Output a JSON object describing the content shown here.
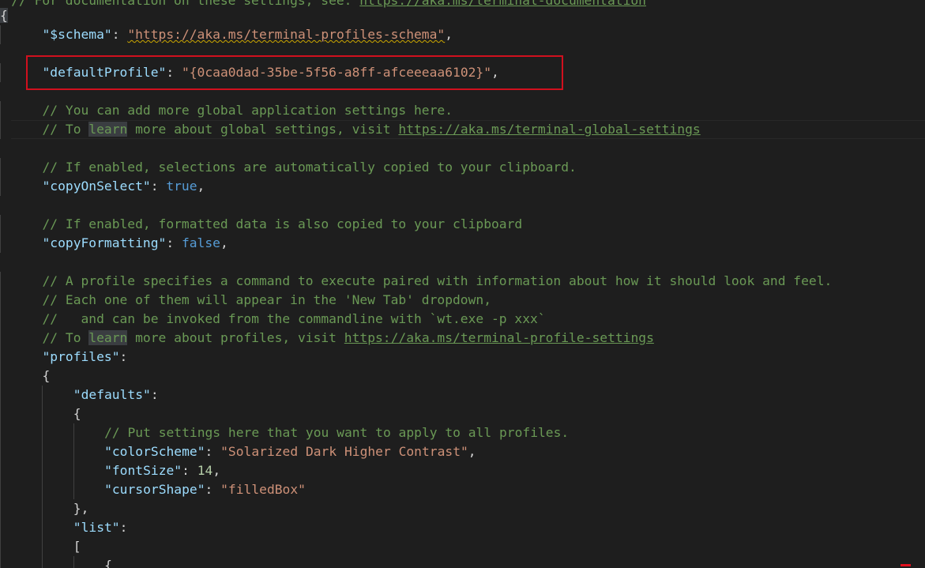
{
  "editor": {
    "lines": {
      "top_comment": {
        "text": "// For documentation on these settings, see: ",
        "url": "https://aka.ms/terminal-documentation"
      },
      "open_brace": "{",
      "schema": {
        "key": "\"$schema\"",
        "colon": ": ",
        "value": "\"https://aka.ms/terminal-profiles-schema\"",
        "tail": ","
      },
      "default_profile": {
        "key": "\"defaultProfile\"",
        "colon": ": ",
        "value": "\"{0caa0dad-35be-5f56-a8ff-afceeeaa6102}\"",
        "tail": ","
      },
      "global_comment_1": "// You can add more global application settings here.",
      "global_comment_2": {
        "prefix": "// To ",
        "learn": "learn",
        "middle": " more about global settings, visit ",
        "url": "https://aka.ms/terminal-global-settings"
      },
      "copy_select_comment": "// If enabled, selections are automatically copied to your clipboard.",
      "copy_on_select": {
        "key": "\"copyOnSelect\"",
        "colon": ": ",
        "value": "true",
        "tail": ","
      },
      "copy_formatting_comment": "// If enabled, formatted data is also copied to your clipboard",
      "copy_formatting": {
        "key": "\"copyFormatting\"",
        "colon": ": ",
        "value": "false",
        "tail": ","
      },
      "profile_comment_1": "// A profile specifies a command to execute paired with information about how it should look and feel.",
      "profile_comment_2": "// Each one of them will appear in the 'New Tab' dropdown,",
      "profile_comment_3": "//   and can be invoked from the commandline with `wt.exe -p xxx`",
      "profile_comment_4": {
        "prefix": "// To ",
        "learn": "learn",
        "middle": " more about profiles, visit ",
        "url": "https://aka.ms/terminal-profile-settings"
      },
      "profiles": {
        "key": "\"profiles\"",
        "colon": ":"
      },
      "profiles_open": "{",
      "defaults": {
        "key": "\"defaults\"",
        "colon": ":"
      },
      "defaults_open": "{",
      "defaults_comment": "// Put settings here that you want to apply to all profiles.",
      "color_scheme": {
        "key": "\"colorScheme\"",
        "colon": ": ",
        "value": "\"Solarized Dark Higher Contrast\"",
        "tail": ","
      },
      "font_size": {
        "key": "\"fontSize\"",
        "colon": ": ",
        "value": "14",
        "tail": ","
      },
      "cursor_shape": {
        "key": "\"cursorShape\"",
        "colon": ": ",
        "value": "\"filledBox\""
      },
      "defaults_close": "},",
      "list": {
        "key": "\"list\"",
        "colon": ":"
      },
      "list_open": "[",
      "item_open": "{"
    }
  },
  "colors": {
    "background": "#1e1e1e",
    "key": "#9cdcfe",
    "string": "#ce9178",
    "comment": "#6a9955",
    "keyword": "#569cd6",
    "number": "#b5cea8",
    "annotation_box": "#d1101e"
  }
}
